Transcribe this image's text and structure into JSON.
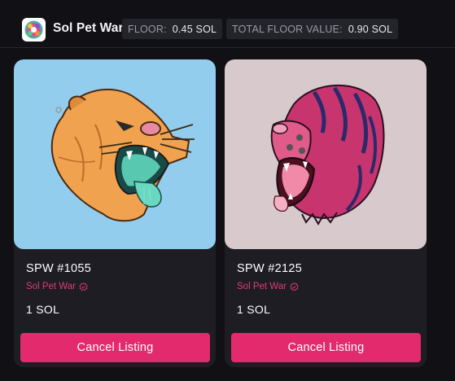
{
  "header": {
    "collection_name": "Sol Pet War",
    "logo_icon": "sol-pet-war-logo",
    "floor_label": "FLOOR:",
    "floor_value": "0.45 SOL",
    "total_floor_label": "TOTAL FLOOR VALUE:",
    "total_floor_value": "0.90 SOL"
  },
  "colors": {
    "accent": "#e22a6c",
    "collection_link": "#e03a7b",
    "card_background": "#1d1d23",
    "page_background": "#111115"
  },
  "listings": [
    {
      "title": "SPW #1055",
      "collection": "Sol Pet War",
      "verified_icon": "verified-badge-icon",
      "price": "1 SOL",
      "action_label": "Cancel Listing",
      "image": "orange-panther-artwork"
    },
    {
      "title": "SPW #2125",
      "collection": "Sol Pet War",
      "verified_icon": "verified-badge-icon",
      "price": "1 SOL",
      "action_label": "Cancel Listing",
      "image": "pink-striped-tiger-artwork"
    }
  ]
}
